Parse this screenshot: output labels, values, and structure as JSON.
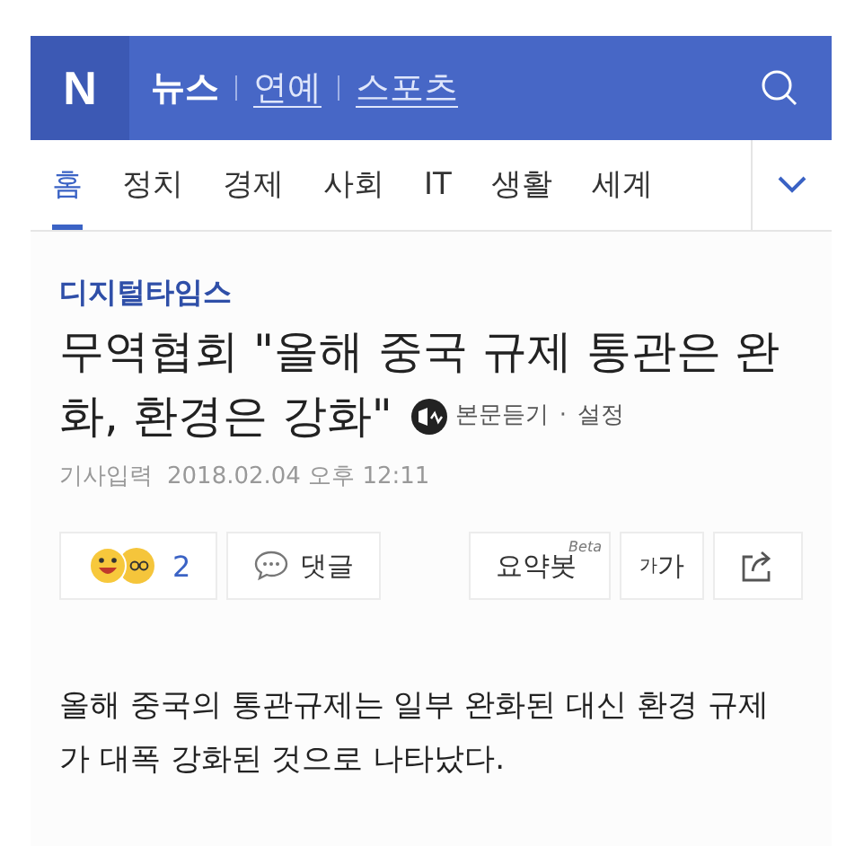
{
  "header": {
    "logo": "N",
    "sections": [
      {
        "label": "뉴스",
        "selected": true
      },
      {
        "label": "연예",
        "selected": false
      },
      {
        "label": "스포츠",
        "selected": false
      }
    ]
  },
  "tabs": [
    {
      "label": "홈",
      "selected": true
    },
    {
      "label": "정치",
      "selected": false
    },
    {
      "label": "경제",
      "selected": false
    },
    {
      "label": "사회",
      "selected": false
    },
    {
      "label": "IT",
      "selected": false
    },
    {
      "label": "생활",
      "selected": false
    },
    {
      "label": "세계",
      "selected": false
    }
  ],
  "article": {
    "press": "디지털타임스",
    "title_lines": [
      "무역협회 \"올해 중국 규제 통관은 완",
      "화, 환경은 강화\""
    ],
    "listen": "본문듣기",
    "separator": "·",
    "settings": "설정",
    "date_label": "기사입력",
    "date": "2018.02.04 오후 12:11",
    "reaction_count": "2",
    "comments": "댓글",
    "summary": "요약봇",
    "summary_badge": "Beta",
    "font_small": "가",
    "font_large": "가",
    "body": "올해 중국의 통관규제는 일부 완화된 대신 환경 규제가 대폭 강화된 것으로 나타났다."
  }
}
